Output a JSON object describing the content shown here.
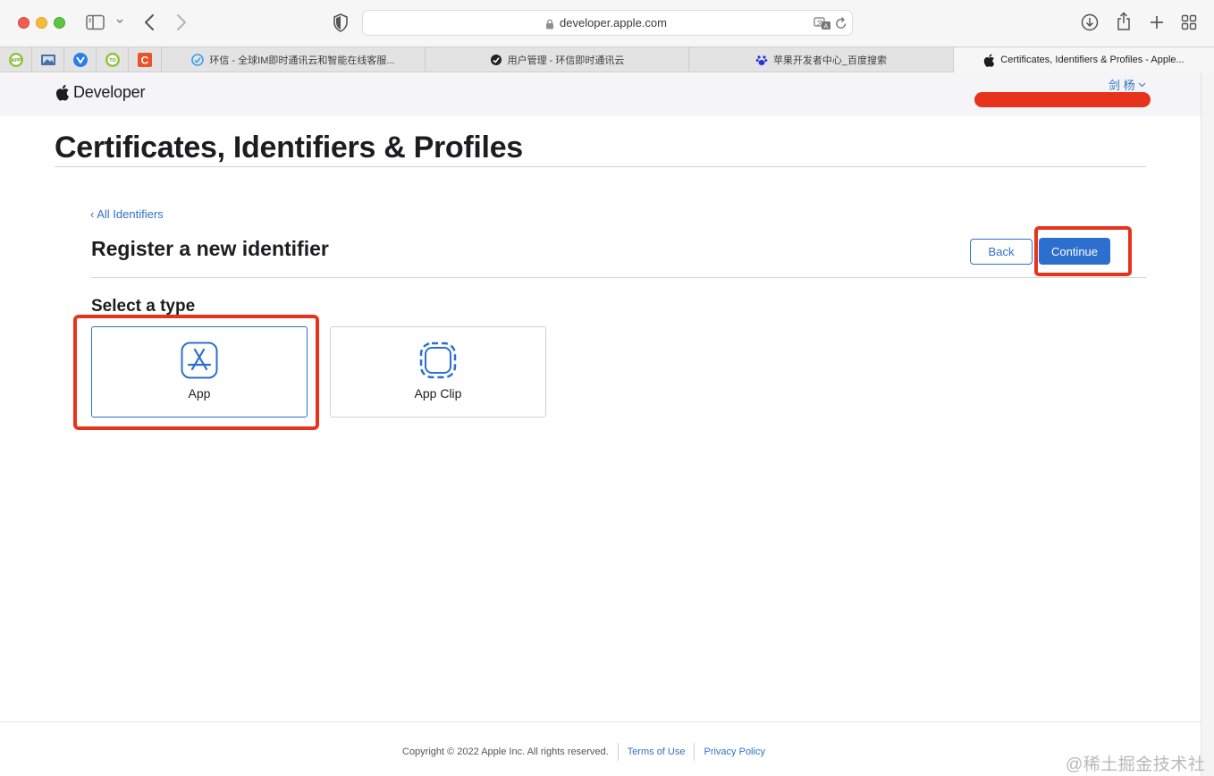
{
  "browser": {
    "url": "developer.apple.com",
    "tabs": [
      {
        "label": "环信 - 全球IM即时通讯云和智能在线客服..."
      },
      {
        "label": "用户管理 - 环信即时通讯云"
      },
      {
        "label": "苹果开发者中心_百度搜索"
      },
      {
        "label": "Certificates, Identifiers & Profiles - Apple..."
      }
    ],
    "pinned_favicons": [
      "app-download-icon",
      "image-icon",
      "shield-v-icon",
      "tool-icon",
      "c-letter-icon"
    ]
  },
  "header": {
    "logo_text": "Developer",
    "account_name": "剑 杨"
  },
  "main": {
    "page_title": "Certificates, Identifiers & Profiles",
    "breadcrumb": "‹ All Identifiers",
    "subtitle": "Register a new identifier",
    "back_label": "Back",
    "continue_label": "Continue",
    "select_type_label": "Select a type",
    "types": [
      {
        "label": "App",
        "icon": "app-store-icon",
        "selected": true
      },
      {
        "label": "App Clip",
        "icon": "app-clip-icon",
        "selected": false
      }
    ]
  },
  "footer": {
    "copyright": "Copyright © 2022 Apple Inc. All rights reserved.",
    "terms_label": "Terms of Use",
    "privacy_label": "Privacy Policy"
  },
  "watermark": "@稀土掘金技术社区",
  "colors": {
    "accent": "#2d6fce",
    "link": "#3071c9",
    "highlight": "#e8331c"
  }
}
